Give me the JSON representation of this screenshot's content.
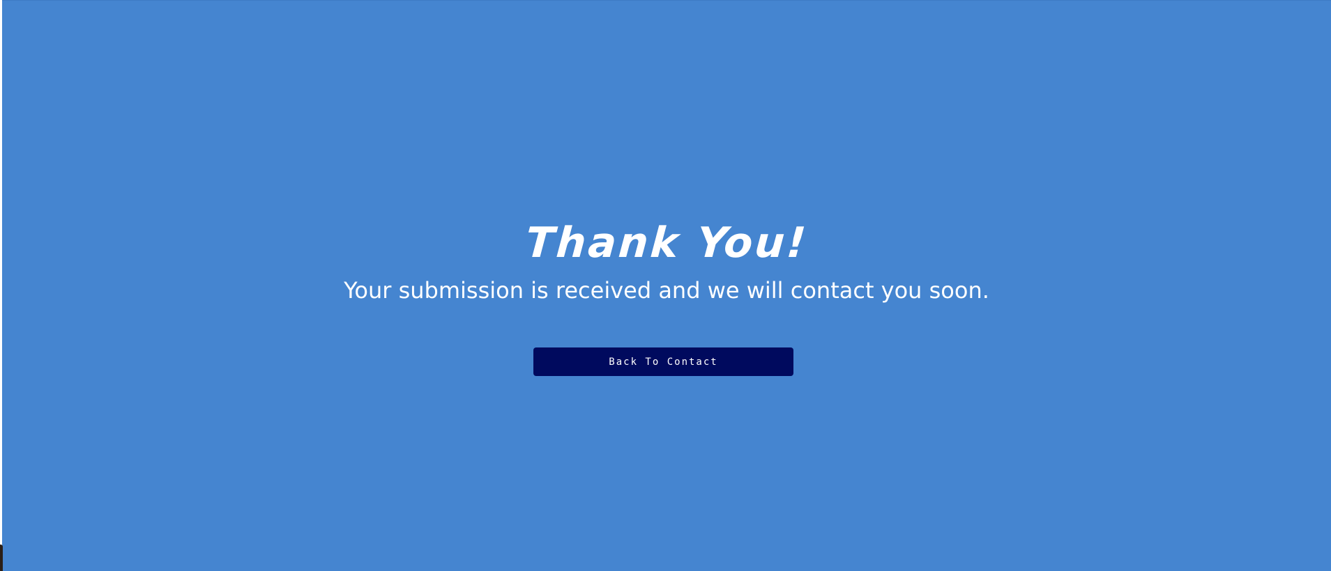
{
  "page": {
    "heading": "Thank You!",
    "message": "Your submission is received and we will contact you soon.",
    "back_button_label": "Back To Contact"
  },
  "colors": {
    "background": "#4585d0",
    "button_background": "#000a5e",
    "text": "#ffffff"
  }
}
